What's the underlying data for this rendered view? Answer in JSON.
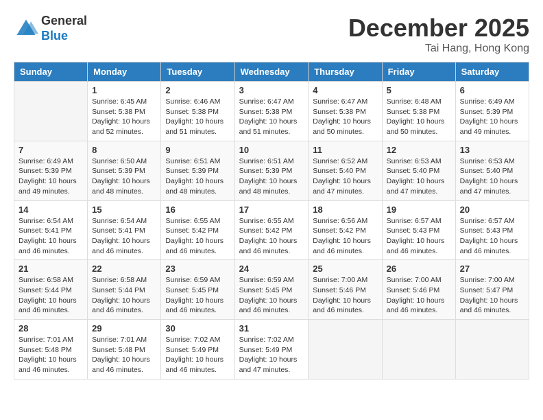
{
  "header": {
    "logo_line1": "General",
    "logo_line2": "Blue",
    "month_title": "December 2025",
    "location": "Tai Hang, Hong Kong"
  },
  "days_of_week": [
    "Sunday",
    "Monday",
    "Tuesday",
    "Wednesday",
    "Thursday",
    "Friday",
    "Saturday"
  ],
  "weeks": [
    [
      {
        "day": "",
        "info": ""
      },
      {
        "day": "1",
        "info": "Sunrise: 6:45 AM\nSunset: 5:38 PM\nDaylight: 10 hours\nand 52 minutes."
      },
      {
        "day": "2",
        "info": "Sunrise: 6:46 AM\nSunset: 5:38 PM\nDaylight: 10 hours\nand 51 minutes."
      },
      {
        "day": "3",
        "info": "Sunrise: 6:47 AM\nSunset: 5:38 PM\nDaylight: 10 hours\nand 51 minutes."
      },
      {
        "day": "4",
        "info": "Sunrise: 6:47 AM\nSunset: 5:38 PM\nDaylight: 10 hours\nand 50 minutes."
      },
      {
        "day": "5",
        "info": "Sunrise: 6:48 AM\nSunset: 5:38 PM\nDaylight: 10 hours\nand 50 minutes."
      },
      {
        "day": "6",
        "info": "Sunrise: 6:49 AM\nSunset: 5:39 PM\nDaylight: 10 hours\nand 49 minutes."
      }
    ],
    [
      {
        "day": "7",
        "info": "Sunrise: 6:49 AM\nSunset: 5:39 PM\nDaylight: 10 hours\nand 49 minutes."
      },
      {
        "day": "8",
        "info": "Sunrise: 6:50 AM\nSunset: 5:39 PM\nDaylight: 10 hours\nand 48 minutes."
      },
      {
        "day": "9",
        "info": "Sunrise: 6:51 AM\nSunset: 5:39 PM\nDaylight: 10 hours\nand 48 minutes."
      },
      {
        "day": "10",
        "info": "Sunrise: 6:51 AM\nSunset: 5:39 PM\nDaylight: 10 hours\nand 48 minutes."
      },
      {
        "day": "11",
        "info": "Sunrise: 6:52 AM\nSunset: 5:40 PM\nDaylight: 10 hours\nand 47 minutes."
      },
      {
        "day": "12",
        "info": "Sunrise: 6:53 AM\nSunset: 5:40 PM\nDaylight: 10 hours\nand 47 minutes."
      },
      {
        "day": "13",
        "info": "Sunrise: 6:53 AM\nSunset: 5:40 PM\nDaylight: 10 hours\nand 47 minutes."
      }
    ],
    [
      {
        "day": "14",
        "info": "Sunrise: 6:54 AM\nSunset: 5:41 PM\nDaylight: 10 hours\nand 46 minutes."
      },
      {
        "day": "15",
        "info": "Sunrise: 6:54 AM\nSunset: 5:41 PM\nDaylight: 10 hours\nand 46 minutes."
      },
      {
        "day": "16",
        "info": "Sunrise: 6:55 AM\nSunset: 5:42 PM\nDaylight: 10 hours\nand 46 minutes."
      },
      {
        "day": "17",
        "info": "Sunrise: 6:55 AM\nSunset: 5:42 PM\nDaylight: 10 hours\nand 46 minutes."
      },
      {
        "day": "18",
        "info": "Sunrise: 6:56 AM\nSunset: 5:42 PM\nDaylight: 10 hours\nand 46 minutes."
      },
      {
        "day": "19",
        "info": "Sunrise: 6:57 AM\nSunset: 5:43 PM\nDaylight: 10 hours\nand 46 minutes."
      },
      {
        "day": "20",
        "info": "Sunrise: 6:57 AM\nSunset: 5:43 PM\nDaylight: 10 hours\nand 46 minutes."
      }
    ],
    [
      {
        "day": "21",
        "info": "Sunrise: 6:58 AM\nSunset: 5:44 PM\nDaylight: 10 hours\nand 46 minutes."
      },
      {
        "day": "22",
        "info": "Sunrise: 6:58 AM\nSunset: 5:44 PM\nDaylight: 10 hours\nand 46 minutes."
      },
      {
        "day": "23",
        "info": "Sunrise: 6:59 AM\nSunset: 5:45 PM\nDaylight: 10 hours\nand 46 minutes."
      },
      {
        "day": "24",
        "info": "Sunrise: 6:59 AM\nSunset: 5:45 PM\nDaylight: 10 hours\nand 46 minutes."
      },
      {
        "day": "25",
        "info": "Sunrise: 7:00 AM\nSunset: 5:46 PM\nDaylight: 10 hours\nand 46 minutes."
      },
      {
        "day": "26",
        "info": "Sunrise: 7:00 AM\nSunset: 5:46 PM\nDaylight: 10 hours\nand 46 minutes."
      },
      {
        "day": "27",
        "info": "Sunrise: 7:00 AM\nSunset: 5:47 PM\nDaylight: 10 hours\nand 46 minutes."
      }
    ],
    [
      {
        "day": "28",
        "info": "Sunrise: 7:01 AM\nSunset: 5:48 PM\nDaylight: 10 hours\nand 46 minutes."
      },
      {
        "day": "29",
        "info": "Sunrise: 7:01 AM\nSunset: 5:48 PM\nDaylight: 10 hours\nand 46 minutes."
      },
      {
        "day": "30",
        "info": "Sunrise: 7:02 AM\nSunset: 5:49 PM\nDaylight: 10 hours\nand 46 minutes."
      },
      {
        "day": "31",
        "info": "Sunrise: 7:02 AM\nSunset: 5:49 PM\nDaylight: 10 hours\nand 47 minutes."
      },
      {
        "day": "",
        "info": ""
      },
      {
        "day": "",
        "info": ""
      },
      {
        "day": "",
        "info": ""
      }
    ]
  ]
}
